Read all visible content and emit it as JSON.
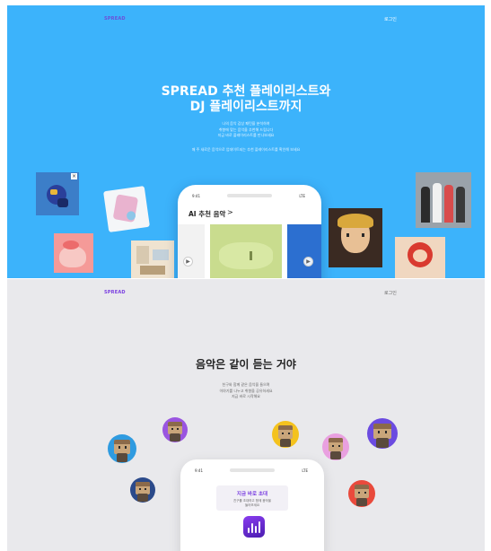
{
  "colors": {
    "hero_bg": "#3cb3fb",
    "social_bg": "#e9e9ec",
    "brand_purple": "#7a3fe0",
    "hero_logo": "#6b4fd8",
    "title_dark": "#222222",
    "text_gray": "#666666"
  },
  "hero": {
    "logo": "SPREAD",
    "login": "로그인",
    "title_line1": "SPREAD 추천 플레이리스트와",
    "title_line2": "DJ 플레이리스트까지",
    "desc_line1": "나의 음악 감상 패턴을 분석하여",
    "desc_line2": "취향에 맞는 음악을 추천해 드립니다",
    "desc_line3": "지금 바로 플레이리스트를 만나보세요",
    "note": "매 주 새로운 음악으로 업데이트되는 추천 플레이리스트를 확인해 보세요",
    "phone": {
      "time": "9:41",
      "status": "LTE",
      "section_title": "AI 추천 음악",
      "arrow": ">"
    }
  },
  "social": {
    "logo": "SPREAD",
    "login": "로그인",
    "title": "음악은 같이 듣는 거야",
    "desc_line1": "친구와 함께 같은 음악을 들으며",
    "desc_line2": "이야기를 나누고 취향을 공유하세요",
    "desc_line3": "지금 바로 시작해요",
    "phone": {
      "time": "9:41",
      "status": "LTE",
      "invite_title": "지금 바로 초대",
      "invite_sub_line1": "친구를 초대하고 함께 음악을",
      "invite_sub_line2": "들어보세요"
    }
  },
  "icons": {
    "play": "▶",
    "close": "×"
  }
}
